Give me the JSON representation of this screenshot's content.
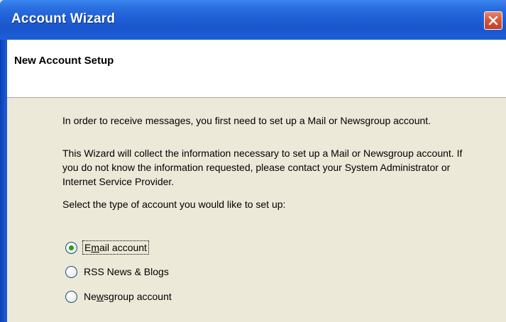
{
  "window": {
    "title": "Account Wizard"
  },
  "header": {
    "title": "New Account Setup"
  },
  "content": {
    "paragraph1": "In order to receive messages, you first need to set up a Mail or Newsgroup account.",
    "paragraph2": "This Wizard will collect the information necessary to set up a Mail or Newsgroup account. If you do not know the information requested, please contact your System Administrator or Internet Service Provider.",
    "paragraph3": "Select the type of account you would like to set up:"
  },
  "options": [
    {
      "label_pre": "E",
      "label_access": "m",
      "label_post": "ail account",
      "checked": true
    },
    {
      "label_pre": "RSS News & Blogs",
      "label_access": "",
      "label_post": "",
      "checked": false
    },
    {
      "label_pre": "Ne",
      "label_access": "w",
      "label_post": "sgroup account",
      "checked": false
    }
  ],
  "colors": {
    "titlebar": "#1f5fd6",
    "background": "#ece9d8",
    "close_button": "#d4543a",
    "radio_dot": "#21a121"
  }
}
